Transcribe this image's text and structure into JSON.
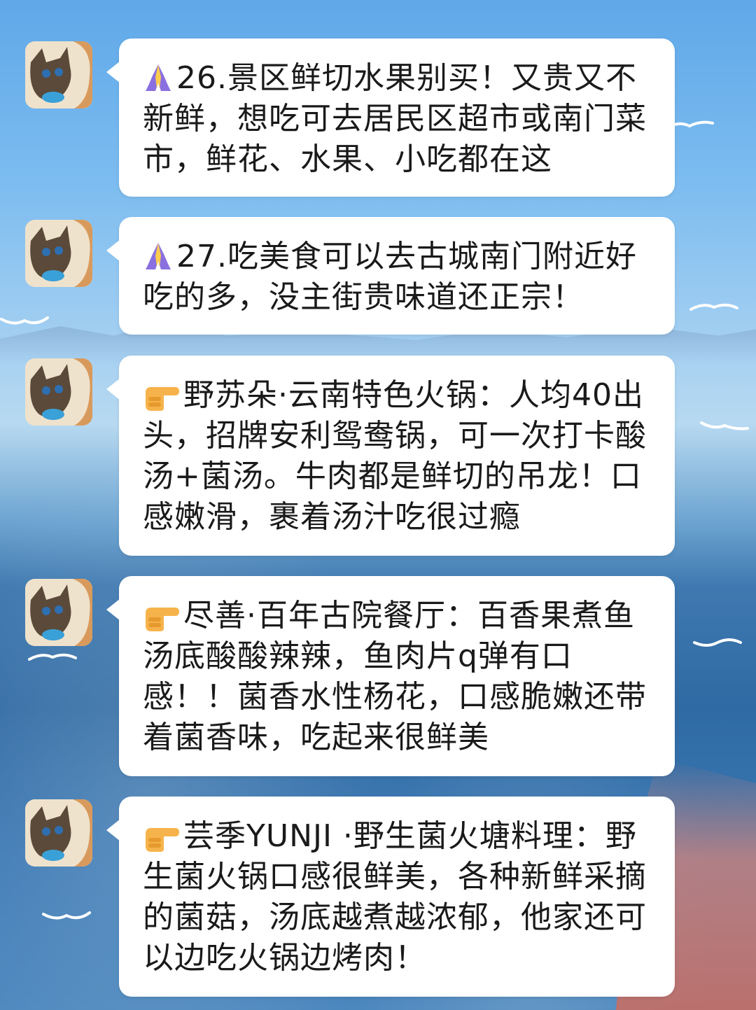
{
  "messages": [
    {
      "icon": "folded-hands-icon",
      "text": "26.景区鲜切水果别买！又贵又不新鲜，想吃可去居民区超市或南门菜市，鲜花、水果、小吃都在这"
    },
    {
      "icon": "folded-hands-icon",
      "text": "27.吃美食可以去古城南门附近好吃的多，没主街贵味道还正宗！"
    },
    {
      "icon": "pointing-hand-icon",
      "text": "野苏朵·云南特色火锅：人均40出头，招牌安利鸳鸯锅，可一次打卡酸汤+菌汤。牛肉都是鲜切的吊龙！口感嫩滑，裹着汤汁吃很过瘾"
    },
    {
      "icon": "pointing-hand-icon",
      "text": "尽善·百年古院餐厅：百香果煮鱼汤底酸酸辣辣，鱼肉片q弹有口感！！菌香水性杨花，口感脆嫩还带着菌香味，吃起来很鲜美"
    },
    {
      "icon": "pointing-hand-icon",
      "text": "芸季YUNJI ·野生菌火塘料理：野生菌火锅口感很鲜美，各种新鲜采摘的菌菇，汤底越煮越浓郁，他家还可以边吃火锅边烤肉！"
    }
  ]
}
